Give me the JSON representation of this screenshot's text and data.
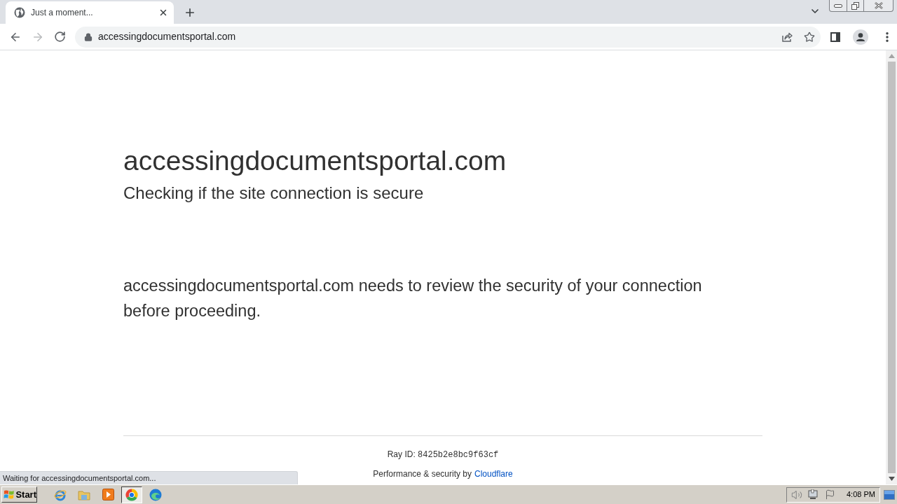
{
  "browser": {
    "tabs": [
      {
        "title": "Just a moment...",
        "selected": true
      }
    ],
    "nav": {
      "forward_disabled": true
    },
    "address_bar": {
      "url": "accessingdocumentsportal.com"
    }
  },
  "page": {
    "heading": "accessingdocumentsportal.com",
    "subheading": "Checking if the site connection is secure",
    "message": "accessingdocumentsportal.com needs to review the security of your connection before proceeding.",
    "ray_id": {
      "label": "Ray ID:",
      "value": "8425b2e8bc9f63cf"
    },
    "footer": {
      "text": "Performance & security by",
      "link": "Cloudflare"
    }
  },
  "status_bubble": "Waiting for accessingdocumentsportal.com...",
  "taskbar": {
    "start": "Start",
    "apps": [
      {
        "kind": "swoosh",
        "selected": false
      },
      {
        "kind": "folder",
        "selected": false
      },
      {
        "kind": "player",
        "selected": false
      },
      {
        "kind": "ring",
        "selected": true
      },
      {
        "kind": "wave",
        "selected": false
      }
    ],
    "clock": "4:08 PM"
  }
}
